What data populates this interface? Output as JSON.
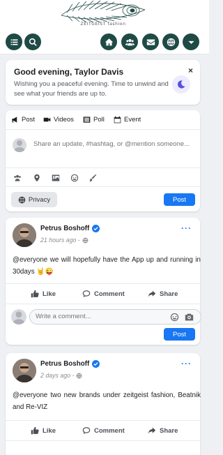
{
  "brand": {
    "logo_text": "ZEITGEIST fashion"
  },
  "greeting": {
    "title": "Good evening, Taylor Davis",
    "message": "Wishing you a peaceful evening. Time to unwind and see what your friends are up to.",
    "close": "×"
  },
  "composer": {
    "tabs": [
      {
        "label": "Post",
        "icon": "megaphone-icon"
      },
      {
        "label": "Videos",
        "icon": "video-icon"
      },
      {
        "label": "Poll",
        "icon": "poll-icon"
      },
      {
        "label": "Event",
        "icon": "calendar-icon"
      }
    ],
    "placeholder": "Share an update, #hashtag, or @mention someone...",
    "tools": [
      "users-icon",
      "location-pin-icon",
      "image-icon",
      "smiley-icon",
      "brush-icon"
    ],
    "privacy_label": "Privacy",
    "post_label": "Post"
  },
  "posts": [
    {
      "author": "Petrus Boshoff",
      "time": "21 hours ago -",
      "text": "@everyone we will hopefully have the App up and running in 30days 🤘😜",
      "actions": {
        "like": "Like",
        "comment": "Comment",
        "share": "Share"
      },
      "comment_placeholder": "Write a comment...",
      "comment_post_label": "Post"
    },
    {
      "author": "Petrus Boshoff",
      "time": "2 days ago -",
      "text": "@everyone two new brands under zeitgeist fashion, Beatnik and Re-VIZ",
      "actions": {
        "like": "Like",
        "comment": "Comment",
        "share": "Share"
      }
    }
  ],
  "colors": {
    "nav": "#1f4a45",
    "accent": "#1877f2",
    "moon": "#5b4fe0"
  }
}
